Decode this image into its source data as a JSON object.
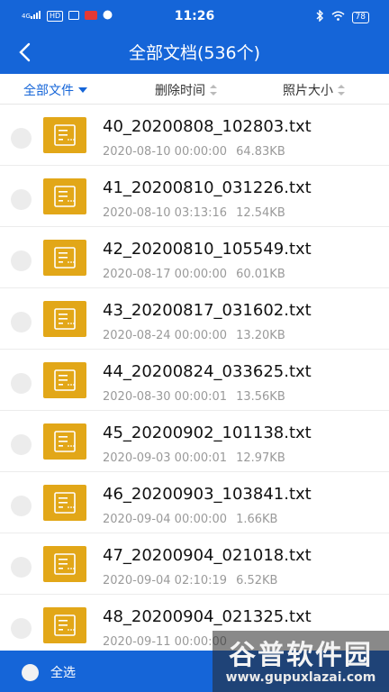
{
  "status_bar": {
    "net_label": "4G",
    "hd_label": "HD",
    "time": "11:26",
    "battery": "78"
  },
  "header": {
    "title": "全部文档(536个)"
  },
  "filters": {
    "type": "全部文件",
    "deleted_time": "删除时间",
    "photo_size": "照片大小"
  },
  "files": [
    {
      "name": "40_20200808_102803.txt",
      "date": "2020-08-10 00:00:00",
      "size": "64.83KB"
    },
    {
      "name": "41_20200810_031226.txt",
      "date": "2020-08-10 03:13:16",
      "size": "12.54KB"
    },
    {
      "name": "42_20200810_105549.txt",
      "date": "2020-08-17 00:00:00",
      "size": "60.01KB"
    },
    {
      "name": "43_20200817_031602.txt",
      "date": "2020-08-24 00:00:00",
      "size": "13.20KB"
    },
    {
      "name": "44_20200824_033625.txt",
      "date": "2020-08-30 00:00:01",
      "size": "13.56KB"
    },
    {
      "name": "45_20200902_101138.txt",
      "date": "2020-09-03 00:00:01",
      "size": "12.97KB"
    },
    {
      "name": "46_20200903_103841.txt",
      "date": "2020-09-04 00:00:00",
      "size": "1.66KB"
    },
    {
      "name": "47_20200904_021018.txt",
      "date": "2020-09-04 02:10:19",
      "size": "6.52KB"
    },
    {
      "name": "48_20200904_021325.txt",
      "date": "2020-09-11 00:00:00",
      "size": ""
    }
  ],
  "footer": {
    "select_all": "全选"
  },
  "watermark": {
    "brand": "谷普软件园",
    "url": "www.gupuxlazai.com"
  },
  "colors": {
    "accent": "#1565d8",
    "file_icon": "#e2a718"
  }
}
